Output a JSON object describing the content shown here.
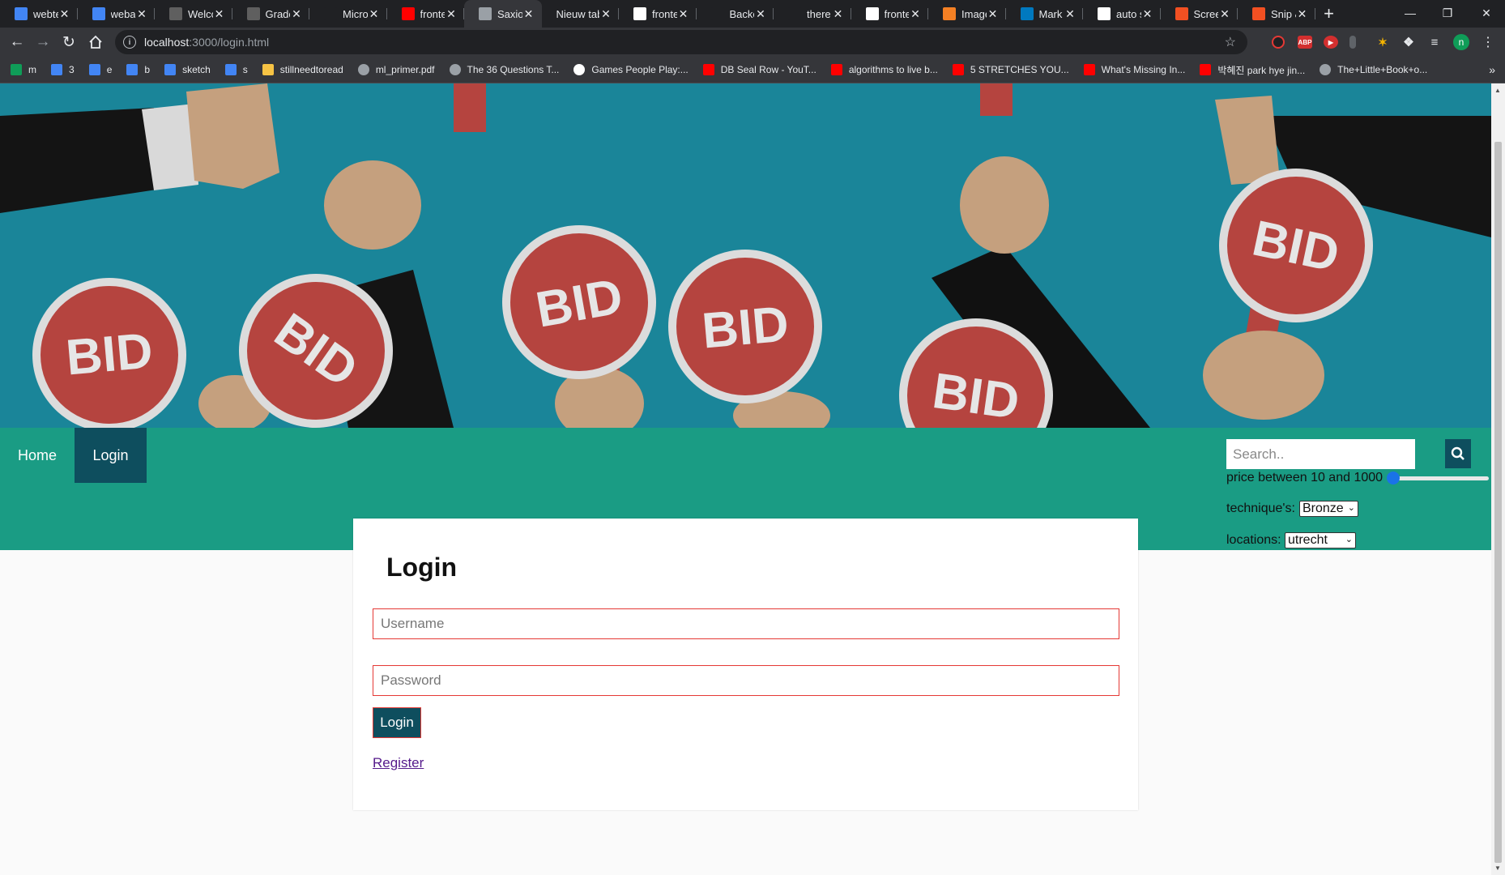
{
  "tabs": [
    {
      "title": "webte",
      "icon": "google-docs-icon",
      "color": "#4285f4"
    },
    {
      "title": "webap",
      "icon": "google-docs-icon",
      "color": "#4285f4"
    },
    {
      "title": "Welco",
      "icon": "blackboard-icon",
      "color": "#5f5f5f"
    },
    {
      "title": "Grade",
      "icon": "blackboard-icon",
      "color": "#5f5f5f"
    },
    {
      "title": "Micro",
      "icon": "blackboard-text-icon",
      "color": "#202124"
    },
    {
      "title": "fronte",
      "icon": "youtube-icon",
      "color": "#ff0000"
    },
    {
      "title": "Saxion",
      "icon": "globe-icon",
      "color": "#9aa0a6",
      "active": true
    },
    {
      "title": "Nieuw tab",
      "icon": "none",
      "color": "#202124"
    },
    {
      "title": "fronte",
      "icon": "google-icon",
      "color": "#ffffff"
    },
    {
      "title": "Backe",
      "icon": "medium-icon",
      "color": "#202124"
    },
    {
      "title": "there",
      "icon": "github-icon",
      "color": "#202124"
    },
    {
      "title": "fronte",
      "icon": "google-icon",
      "color": "#ffffff"
    },
    {
      "title": "Image",
      "icon": "stackoverflow-icon",
      "color": "#f48024"
    },
    {
      "title": "Mark",
      "icon": "trello-icon",
      "color": "#0079bf"
    },
    {
      "title": "auto s",
      "icon": "google-icon",
      "color": "#ffffff"
    },
    {
      "title": "Scree",
      "icon": "microsoft-icon",
      "color": "#f25022"
    },
    {
      "title": "Snip &",
      "icon": "microsoft-icon",
      "color": "#f25022"
    }
  ],
  "toolbar": {
    "url_host": "localhost",
    "url_path": ":3000/login.html",
    "profile_initial": "n"
  },
  "bookmarks": [
    {
      "label": "m",
      "icon": "google-sheets-icon",
      "color": "#0f9d58"
    },
    {
      "label": "3",
      "icon": "google-docs-icon",
      "color": "#4285f4"
    },
    {
      "label": "e",
      "icon": "google-docs-icon",
      "color": "#4285f4"
    },
    {
      "label": "b",
      "icon": "google-docs-icon",
      "color": "#4285f4"
    },
    {
      "label": "sketch",
      "icon": "google-docs-icon",
      "color": "#4285f4"
    },
    {
      "label": "s",
      "icon": "google-docs-icon",
      "color": "#4285f4"
    },
    {
      "label": "stillneedtoread",
      "icon": "folder-icon",
      "color": "#f6c344"
    },
    {
      "label": "ml_primer.pdf",
      "icon": "globe-icon",
      "color": "#9aa0a6"
    },
    {
      "label": "The 36 Questions T...",
      "icon": "nyt-icon",
      "color": "#9aa0a6"
    },
    {
      "label": "Games People Play:...",
      "icon": "google-icon",
      "color": "#ffffff"
    },
    {
      "label": "DB Seal Row - YouT...",
      "icon": "youtube-icon",
      "color": "#ff0000"
    },
    {
      "label": "algorithms to live b...",
      "icon": "youtube-icon",
      "color": "#ff0000"
    },
    {
      "label": "5 STRETCHES YOU...",
      "icon": "youtube-icon",
      "color": "#ff0000"
    },
    {
      "label": "What's Missing In...",
      "icon": "youtube-icon",
      "color": "#ff0000"
    },
    {
      "label": "박혜진 park hye jin...",
      "icon": "youtube-icon",
      "color": "#ff0000"
    },
    {
      "label": "The+Little+Book+o...",
      "icon": "globe-icon",
      "color": "#9aa0a6"
    }
  ],
  "nav": {
    "home": "Home",
    "login": "Login"
  },
  "filters": {
    "search_placeholder": "Search..",
    "price_label": "price between 10 and 1000",
    "price_slider_value": 0.05,
    "technique_label": "technique's:",
    "technique_value": "Bronze",
    "locations_label": "locations:",
    "locations_value": "utrecht"
  },
  "hero": {
    "sign_text": "BID",
    "background": "#1a8599",
    "sign_color": "#b5443f"
  },
  "login": {
    "title": "Login",
    "username_placeholder": "Username",
    "password_placeholder": "Password",
    "button": "Login",
    "register": "Register"
  }
}
